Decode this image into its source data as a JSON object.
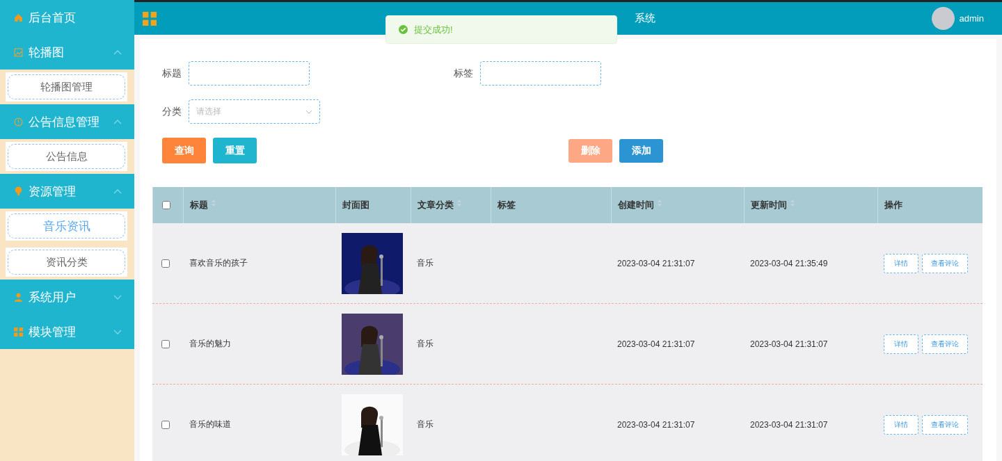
{
  "sidebar": {
    "items": [
      {
        "label": "后台首页",
        "kind": "link"
      },
      {
        "label": "轮播图",
        "kind": "group",
        "expanded": true,
        "children": [
          {
            "label": "轮播图管理",
            "selected": false
          }
        ]
      },
      {
        "label": "公告信息管理",
        "kind": "group",
        "expanded": true,
        "children": [
          {
            "label": "公告信息",
            "selected": false
          }
        ]
      },
      {
        "label": "资源管理",
        "kind": "group",
        "expanded": true,
        "children": [
          {
            "label": "音乐资讯",
            "selected": true
          },
          {
            "label": "资讯分类",
            "selected": false
          }
        ]
      },
      {
        "label": "系统用户",
        "kind": "group",
        "expanded": false
      },
      {
        "label": "模块管理",
        "kind": "group",
        "expanded": false
      }
    ]
  },
  "header": {
    "title": "系统",
    "user": "admin"
  },
  "toast": {
    "text": "提交成功!"
  },
  "search": {
    "fields": [
      {
        "label": "标题",
        "kind": "input"
      },
      {
        "label": "标签",
        "kind": "input"
      },
      {
        "label": "分类",
        "kind": "select",
        "placeholder": "请选择"
      }
    ],
    "buttons": [
      {
        "label": "查询",
        "kind": "query"
      },
      {
        "label": "重置",
        "kind": "reset"
      },
      {
        "label": "删除",
        "kind": "delete",
        "disabled": true
      },
      {
        "label": "添加",
        "kind": "add"
      }
    ]
  },
  "table": {
    "select_all_checked": false,
    "columns": [
      {
        "label": "标题",
        "kind": "sort"
      },
      {
        "label": "封面图",
        "kind": "plain"
      },
      {
        "label": "文章分类",
        "kind": "sort"
      },
      {
        "label": "标签",
        "kind": "plain"
      },
      {
        "label": "创建时间",
        "kind": "sort"
      },
      {
        "label": "更新时间",
        "kind": "sort"
      },
      {
        "label": "操作",
        "kind": "plain"
      }
    ],
    "rows": [
      {
        "checked": false,
        "title": "喜欢音乐的孩子",
        "cover": {
          "kind": "picture"
        },
        "category": "音乐",
        "created": "2023-03-04 21:31:07",
        "updated": "2023-03-04 21:35:49",
        "actions": [
          "详情",
          "查看评论"
        ]
      },
      {
        "checked": false,
        "title": "音乐的魅力",
        "cover": {
          "kind": "picture"
        },
        "category": "音乐",
        "created": "2023-03-04 21:31:07",
        "updated": "2023-03-04 21:31:07",
        "actions": [
          "详情",
          "查看评论"
        ]
      },
      {
        "checked": false,
        "title": "音乐的味道",
        "cover": {
          "kind": "picture"
        },
        "category": "音乐",
        "created": "2023-03-04 21:31:07",
        "updated": "2023-03-04 21:31:07",
        "actions": [
          "详情",
          "查看评论"
        ]
      }
    ]
  }
}
